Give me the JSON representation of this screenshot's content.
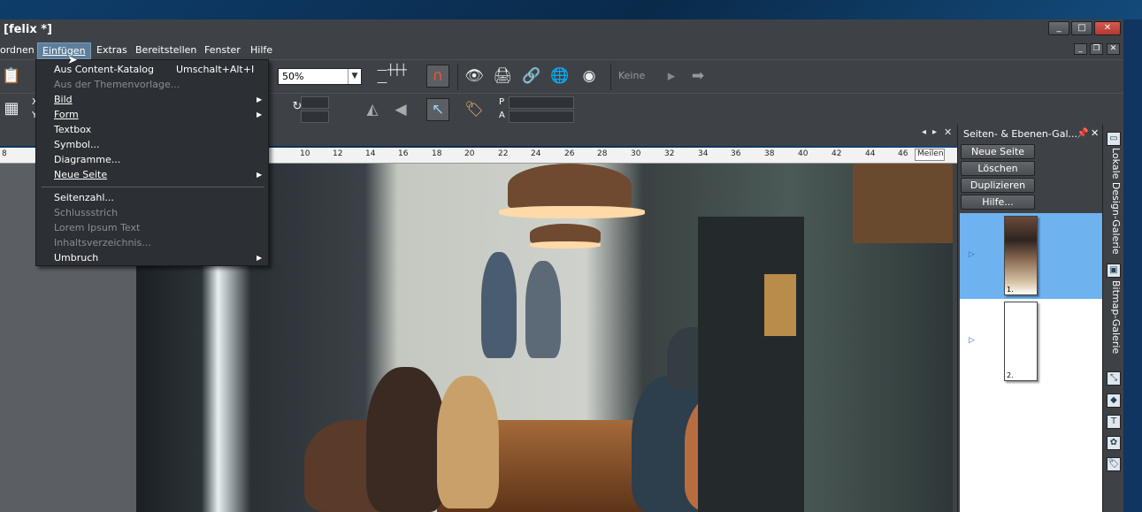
{
  "window": {
    "title": "[felix *]",
    "controls": [
      "_",
      "□",
      "✕"
    ]
  },
  "menubar": {
    "items": [
      "ordnen",
      "Einfügen",
      "Extras",
      "Bereitstellen",
      "Fenster",
      "Hilfe"
    ],
    "active": "Einfügen"
  },
  "toolbar": {
    "zoom_value": "50%",
    "keine_label": "Keine",
    "p_label": "P",
    "a_label": "A",
    "xy_labels": [
      "X",
      "Y"
    ]
  },
  "dropdown": {
    "items": [
      {
        "label": "Aus Content-Katalog",
        "shortcut": "Umschalt+Alt+I",
        "disabled": false,
        "submenu": false
      },
      {
        "label": "Aus der Themenvorlage...",
        "disabled": true,
        "submenu": false
      },
      {
        "label": "Bild",
        "disabled": false,
        "submenu": true
      },
      {
        "label": "Form",
        "disabled": false,
        "submenu": true
      },
      {
        "label": "Textbox",
        "disabled": false,
        "submenu": false
      },
      {
        "label": "Symbol...",
        "disabled": false,
        "submenu": false
      },
      {
        "label": "Diagramme...",
        "disabled": false,
        "submenu": false
      },
      {
        "label": "Neue Seite",
        "disabled": false,
        "submenu": true
      },
      {
        "label": "Seitenzahl...",
        "disabled": false,
        "submenu": false
      },
      {
        "label": "Schlussstrich",
        "disabled": true,
        "submenu": false
      },
      {
        "label": "Lorem Ipsum Text",
        "disabled": true,
        "submenu": false
      },
      {
        "label": "Inhaltsverzeichnis...",
        "disabled": true,
        "submenu": false
      },
      {
        "label": "Umbruch",
        "disabled": false,
        "submenu": true
      }
    ]
  },
  "ruler": {
    "numbers": [
      "8",
      "10",
      "12",
      "14",
      "16",
      "18",
      "20",
      "22",
      "24",
      "26",
      "28",
      "30",
      "32",
      "34",
      "36",
      "38",
      "40",
      "42",
      "44",
      "46"
    ],
    "unit": "Meilen"
  },
  "panel": {
    "title": "Seiten- & Ebenen-Gal...",
    "buttons": [
      "Neue Seite",
      "Löschen",
      "Duplizieren",
      "Hilfe..."
    ],
    "pages": [
      "1.",
      "2."
    ]
  },
  "side_tabs": [
    "Lokale Design-Galerie",
    "Bitmap-Galerie"
  ],
  "colors": {
    "accent": "#5e7f9c",
    "selection": "#6fb2f0",
    "chrome": "#3e4247"
  }
}
